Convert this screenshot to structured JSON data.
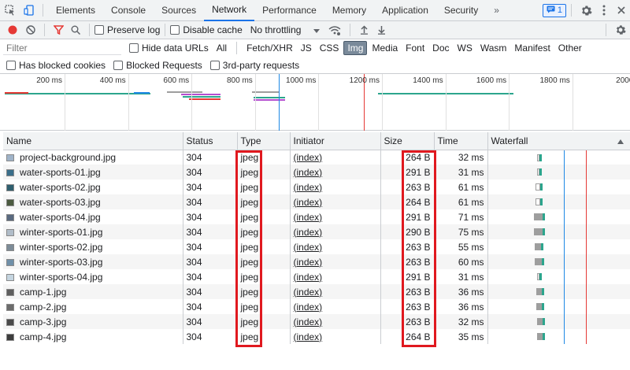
{
  "tabs": [
    "Elements",
    "Console",
    "Sources",
    "Network",
    "Performance",
    "Memory",
    "Application",
    "Security"
  ],
  "active_tab": "Network",
  "more_tabs_label": "»",
  "issues_count": "1",
  "toolbar": {
    "preserve_log": "Preserve log",
    "disable_cache": "Disable cache",
    "throttling": "No throttling"
  },
  "filter": {
    "placeholder": "Filter",
    "hide_data_urls": "Hide data URLs",
    "types": [
      "All",
      "Fetch/XHR",
      "JS",
      "CSS",
      "Img",
      "Media",
      "Font",
      "Doc",
      "WS",
      "Wasm",
      "Manifest",
      "Other"
    ],
    "active_type": "Img",
    "has_blocked_cookies": "Has blocked cookies",
    "blocked_requests": "Blocked Requests",
    "third_party": "3rd-party requests"
  },
  "overview_ticks": [
    "200 ms",
    "400 ms",
    "600 ms",
    "800 ms",
    "1000 ms",
    "1200 ms",
    "1400 ms",
    "1600 ms",
    "1800 ms",
    "2000"
  ],
  "columns": [
    "Name",
    "Status",
    "Type",
    "Initiator",
    "Size",
    "Time",
    "Waterfall"
  ],
  "rows": [
    {
      "name": "project-background.jpg",
      "status": "304",
      "type": "jpeg",
      "initiator": "(index)",
      "size": "264 B",
      "time": "32 ms"
    },
    {
      "name": "water-sports-01.jpg",
      "status": "304",
      "type": "jpeg",
      "initiator": "(index)",
      "size": "291 B",
      "time": "31 ms"
    },
    {
      "name": "water-sports-02.jpg",
      "status": "304",
      "type": "jpeg",
      "initiator": "(index)",
      "size": "263 B",
      "time": "61 ms"
    },
    {
      "name": "water-sports-03.jpg",
      "status": "304",
      "type": "jpeg",
      "initiator": "(index)",
      "size": "264 B",
      "time": "61 ms"
    },
    {
      "name": "water-sports-04.jpg",
      "status": "304",
      "type": "jpeg",
      "initiator": "(index)",
      "size": "291 B",
      "time": "71 ms"
    },
    {
      "name": "winter-sports-01.jpg",
      "status": "304",
      "type": "jpeg",
      "initiator": "(index)",
      "size": "290 B",
      "time": "75 ms"
    },
    {
      "name": "winter-sports-02.jpg",
      "status": "304",
      "type": "jpeg",
      "initiator": "(index)",
      "size": "263 B",
      "time": "55 ms"
    },
    {
      "name": "winter-sports-03.jpg",
      "status": "304",
      "type": "jpeg",
      "initiator": "(index)",
      "size": "263 B",
      "time": "60 ms"
    },
    {
      "name": "winter-sports-04.jpg",
      "status": "304",
      "type": "jpeg",
      "initiator": "(index)",
      "size": "291 B",
      "time": "31 ms"
    },
    {
      "name": "camp-1.jpg",
      "status": "304",
      "type": "jpeg",
      "initiator": "(index)",
      "size": "263 B",
      "time": "36 ms"
    },
    {
      "name": "camp-2.jpg",
      "status": "304",
      "type": "jpeg",
      "initiator": "(index)",
      "size": "263 B",
      "time": "36 ms"
    },
    {
      "name": "camp-3.jpg",
      "status": "304",
      "type": "jpeg",
      "initiator": "(index)",
      "size": "263 B",
      "time": "32 ms"
    },
    {
      "name": "camp-4.jpg",
      "status": "304",
      "type": "jpeg",
      "initiator": "(index)",
      "size": "264 B",
      "time": "35 ms"
    }
  ],
  "colors": {
    "highlight": "#e0191f",
    "accent": "#1a73e8",
    "load_line": "#e53935",
    "dcl_line": "#1e88e5",
    "waiting": "#2ca58d",
    "waterfall_gray": "#9e9e9e"
  },
  "icons": [
    "inspect-icon",
    "device-toggle-icon",
    "issues-icon",
    "settings-gear-icon",
    "kebab-menu-icon",
    "close-icon",
    "record-icon",
    "clear-icon",
    "filter-icon",
    "search-icon",
    "network-conditions-icon",
    "import-icon",
    "export-icon",
    "sort-up-icon"
  ]
}
